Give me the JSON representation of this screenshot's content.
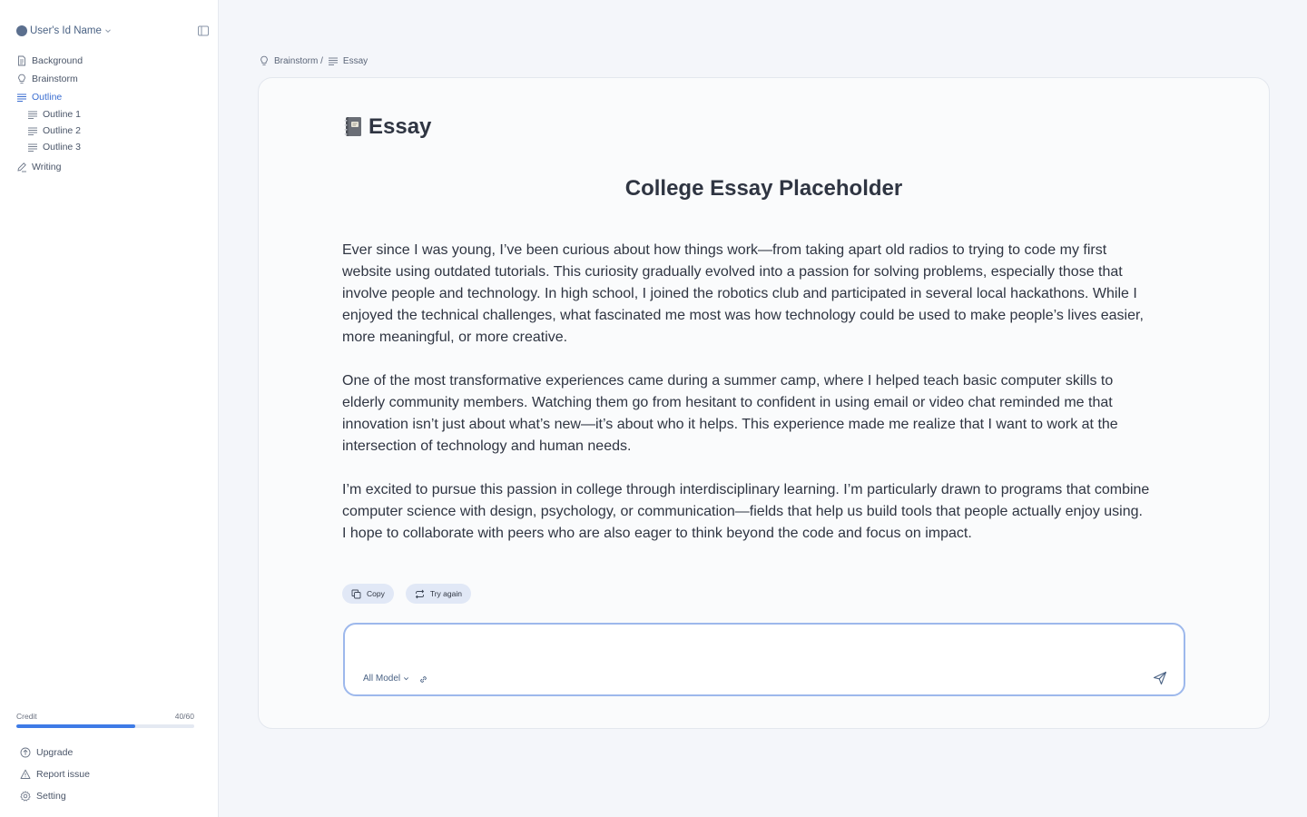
{
  "sidebar": {
    "user_name": "User's Id Name",
    "nav": {
      "background": "Background",
      "brainstorm": "Brainstorm",
      "outline": "Outline",
      "outline_items": [
        "Outline 1",
        "Outline 2",
        "Outline 3"
      ],
      "writing": "Writing"
    },
    "credit": {
      "label": "Credit",
      "value_text": "40/60",
      "fraction": 0.67
    },
    "bottom": {
      "upgrade": "Upgrade",
      "report": "Report issue",
      "setting": "Setting"
    }
  },
  "breadcrumb": {
    "parent": "Brainstorm /",
    "current": "Essay"
  },
  "document": {
    "title": "Essay",
    "heading": "College Essay Placeholder",
    "paragraphs": [
      "Ever since I was young, I’ve been curious about how things work—from taking apart old radios to trying to code my first website using outdated tutorials. This curiosity gradually evolved into a passion for solving problems, especially those that involve people and technology. In high school, I joined the robotics club and participated in several local hackathons. While I enjoyed the technical challenges, what fascinated me most was how technology could be used to make people’s lives easier, more meaningful, or more creative.",
      "One of the most transformative experiences came during a summer camp, where I helped teach basic computer skills to elderly community members. Watching them go from hesitant to confident in using email or video chat reminded me that innovation isn’t just about what’s new—it’s about who it helps. This experience made me realize that I want to work at the intersection of technology and human needs.",
      "I’m excited to pursue this passion in college through interdisciplinary learning. I’m particularly drawn to programs that combine computer science with design, psychology, or communication—fields that help us build tools that people actually enjoy using. I hope to collaborate with peers who are also eager to think beyond the code and focus on impact."
    ]
  },
  "actions": {
    "copy": "Copy",
    "try_again": "Try again"
  },
  "composer": {
    "input_value": "",
    "model": "All Model"
  },
  "colors": {
    "accent": "#3b6ed1",
    "credit_fill": "#3e7be6",
    "composer_border": "#9db8ec"
  }
}
